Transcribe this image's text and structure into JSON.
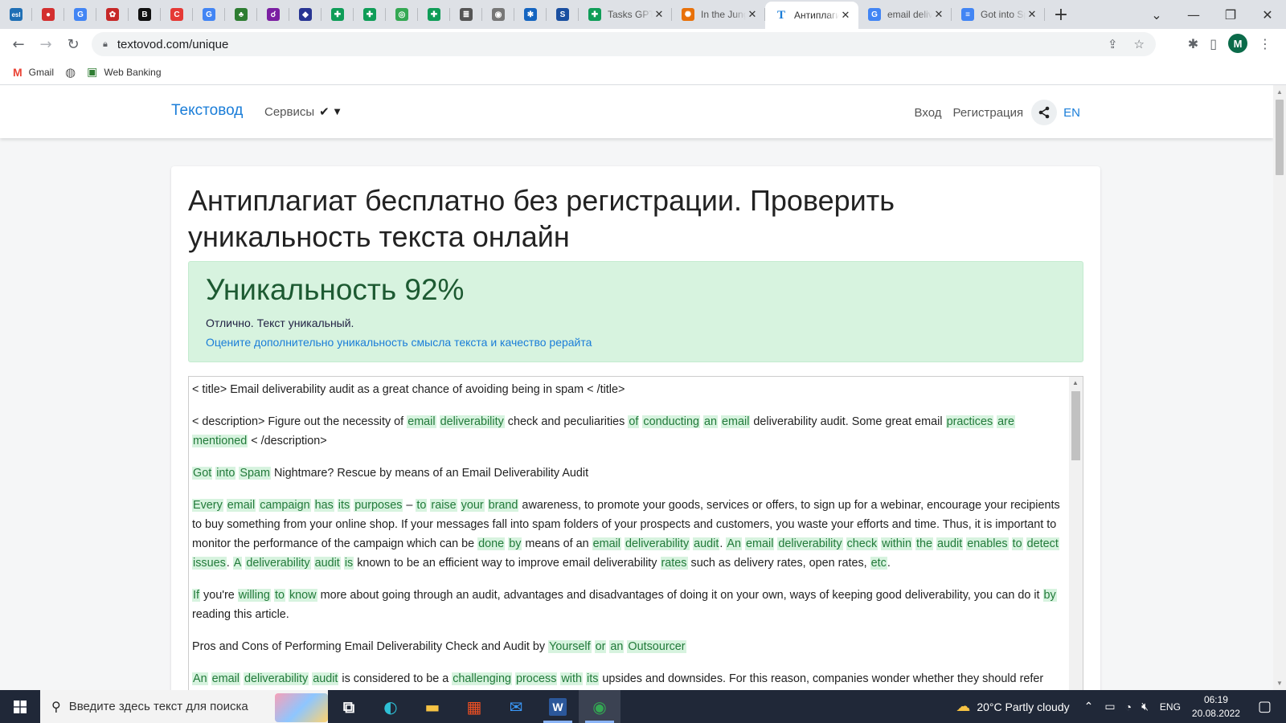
{
  "browser": {
    "pinned_tabs": [
      {
        "icon": "esl-icon",
        "glyph": "esl",
        "color": "#1f6fb5"
      },
      {
        "icon": "red-circle-icon",
        "glyph": "●",
        "color": "#d32f2f"
      },
      {
        "icon": "google-icon",
        "glyph": "G",
        "color": "#4285f4"
      },
      {
        "icon": "berry-icon",
        "glyph": "✿",
        "color": "#c62828"
      },
      {
        "icon": "b-icon",
        "glyph": "B",
        "color": "#111111"
      },
      {
        "icon": "c-icon",
        "glyph": "C",
        "color": "#e53935"
      },
      {
        "icon": "google-icon",
        "glyph": "G",
        "color": "#4285f4"
      },
      {
        "icon": "tree-icon",
        "glyph": "♣",
        "color": "#2e7d32"
      },
      {
        "icon": "gradient-swirl-icon",
        "glyph": "☌",
        "color": "#7b1fa2"
      },
      {
        "icon": "blue-shield-icon",
        "glyph": "◆",
        "color": "#283593"
      },
      {
        "icon": "sheets-icon",
        "glyph": "✚",
        "color": "#0f9d58"
      },
      {
        "icon": "sheets-icon",
        "glyph": "✚",
        "color": "#0f9d58"
      },
      {
        "icon": "green-doc-icon",
        "glyph": "◎",
        "color": "#34a853"
      },
      {
        "icon": "sheets-icon",
        "glyph": "✚",
        "color": "#0f9d58"
      },
      {
        "icon": "note-icon",
        "glyph": "≣",
        "color": "#555555"
      },
      {
        "icon": "eye-icon",
        "glyph": "◉",
        "color": "#777777"
      },
      {
        "icon": "puzzle-icon",
        "glyph": "✱",
        "color": "#1565c0"
      },
      {
        "icon": "circle-s-icon",
        "glyph": "S",
        "color": "#1a4fa0"
      }
    ],
    "tabs": [
      {
        "title": "Tasks GPT",
        "icon": "sheets-icon",
        "glyph": "✚",
        "color": "#0f9d58",
        "active": false
      },
      {
        "title": "In the Jungle",
        "icon": "chrome-web-icon",
        "glyph": "✺",
        "color": "#e8710a",
        "active": false
      },
      {
        "title": "Антиплагиат",
        "icon": "textovod-icon",
        "glyph": "T",
        "color": "#1a7dd8",
        "active": true
      },
      {
        "title": "email deliverability",
        "icon": "google-icon",
        "glyph": "G",
        "color": "#4285f4",
        "active": false
      },
      {
        "title": "Got into Spam",
        "icon": "docs-icon",
        "glyph": "≡",
        "color": "#4285f4",
        "active": false
      }
    ],
    "close_glyph": "✕",
    "new_tab": "+",
    "window_controls": [
      "⌄",
      "—",
      "❐",
      "✕"
    ],
    "url": "textovod.com/unique",
    "profile_initial": "M",
    "bookmarks": [
      {
        "label": "Gmail",
        "icon": "gmail-icon"
      },
      {
        "label": "",
        "icon": "globe-icon"
      },
      {
        "label": "Web Banking",
        "icon": "bank-icon"
      }
    ]
  },
  "site": {
    "brand": "Текстовод",
    "services": "Сервисы",
    "login": "Вход",
    "register": "Регистрация",
    "lang": "EN",
    "heading": "Антиплагиат бесплатно без регистрации. Проверить уникальность текста онлайн",
    "result": {
      "uniqueness": "Уникальность 92%",
      "verdict": "Отлично. Текст уникальный.",
      "rewrite_link": "Оцените дополнительно уникальность смысла текста и качество рерайта"
    },
    "paragraphs": [
      [
        [
          "< title> Email deliverability audit as a great chance of avoiding being in spam < /title>",
          0
        ]
      ],
      [
        [
          "< description> Figure out the necessity of ",
          0
        ],
        [
          "email",
          1
        ],
        [
          " ",
          0
        ],
        [
          "deliverability",
          1
        ],
        [
          " check and peculiarities ",
          0
        ],
        [
          "of",
          1
        ],
        [
          " ",
          0
        ],
        [
          "conducting",
          1
        ],
        [
          " ",
          0
        ],
        [
          "an",
          1
        ],
        [
          " ",
          0
        ],
        [
          "email",
          1
        ],
        [
          " deliverability audit. Some great email ",
          0
        ],
        [
          "practices",
          1
        ],
        [
          " ",
          0
        ],
        [
          "are",
          1
        ],
        [
          " ",
          0
        ],
        [
          "mentioned",
          1
        ],
        [
          " < /description>",
          0
        ]
      ],
      [
        [
          "Got",
          1
        ],
        [
          " ",
          0
        ],
        [
          "into",
          1
        ],
        [
          " ",
          0
        ],
        [
          "Spam",
          1
        ],
        [
          " Nightmare? Rescue by means of an Email Deliverability Audit",
          0
        ]
      ],
      [
        [
          "Every",
          1
        ],
        [
          " ",
          0
        ],
        [
          "email",
          1
        ],
        [
          " ",
          0
        ],
        [
          "campaign",
          1
        ],
        [
          " ",
          0
        ],
        [
          "has",
          1
        ],
        [
          " ",
          0
        ],
        [
          "its",
          1
        ],
        [
          " ",
          0
        ],
        [
          "purposes",
          1
        ],
        [
          " – ",
          0
        ],
        [
          "to",
          1
        ],
        [
          " ",
          0
        ],
        [
          "raise",
          1
        ],
        [
          " ",
          0
        ],
        [
          "your",
          1
        ],
        [
          " ",
          0
        ],
        [
          "brand",
          1
        ],
        [
          " awareness, to promote your goods, services or offers, to sign up for a webinar, encourage your recipients to buy something from your online shop. If your messages fall into spam folders of your prospects and customers, you waste your efforts and time. Thus, it is important to monitor the performance of the campaign which can be ",
          0
        ],
        [
          "done",
          1
        ],
        [
          " ",
          0
        ],
        [
          "by",
          1
        ],
        [
          " means of an ",
          0
        ],
        [
          "email",
          1
        ],
        [
          " ",
          0
        ],
        [
          "deliverability",
          1
        ],
        [
          " ",
          0
        ],
        [
          "audit",
          1
        ],
        [
          ". ",
          0
        ],
        [
          "An",
          1
        ],
        [
          " ",
          0
        ],
        [
          "email",
          1
        ],
        [
          " ",
          0
        ],
        [
          "deliverability",
          1
        ],
        [
          " ",
          0
        ],
        [
          "check",
          1
        ],
        [
          " ",
          0
        ],
        [
          "within",
          1
        ],
        [
          " ",
          0
        ],
        [
          "the",
          1
        ],
        [
          " ",
          0
        ],
        [
          "audit",
          1
        ],
        [
          " ",
          0
        ],
        [
          "enables",
          1
        ],
        [
          " ",
          0
        ],
        [
          "to",
          1
        ],
        [
          " ",
          0
        ],
        [
          "detect",
          1
        ],
        [
          " ",
          0
        ],
        [
          "issues",
          1
        ],
        [
          ". ",
          0
        ],
        [
          "A",
          1
        ],
        [
          " ",
          0
        ],
        [
          "deliverability",
          1
        ],
        [
          " ",
          0
        ],
        [
          "audit",
          1
        ],
        [
          " ",
          0
        ],
        [
          "is",
          1
        ],
        [
          " known to be an efficient way to improve email deliverability ",
          0
        ],
        [
          "rates",
          1
        ],
        [
          " such as delivery rates, open rates, ",
          0
        ],
        [
          "etc",
          1
        ],
        [
          ".",
          0
        ]
      ],
      [
        [
          "If",
          1
        ],
        [
          " you're ",
          0
        ],
        [
          "willing",
          1
        ],
        [
          " ",
          0
        ],
        [
          "to",
          1
        ],
        [
          " ",
          0
        ],
        [
          "know",
          1
        ],
        [
          " more about going through an audit, advantages and disadvantages of doing it on your own, ways of keeping good deliverability, you can do it ",
          0
        ],
        [
          "by",
          1
        ],
        [
          " reading this article.",
          0
        ]
      ],
      [
        [
          "Pros and Cons of Performing Email Deliverability Check and Audit by ",
          0
        ],
        [
          "Yourself",
          1
        ],
        [
          " ",
          0
        ],
        [
          "or",
          1
        ],
        [
          " ",
          0
        ],
        [
          "an",
          1
        ],
        [
          " ",
          0
        ],
        [
          "Outsourcer",
          1
        ]
      ],
      [
        [
          "An",
          1
        ],
        [
          " ",
          0
        ],
        [
          "email",
          1
        ],
        [
          " ",
          0
        ],
        [
          "deliverability",
          1
        ],
        [
          " ",
          0
        ],
        [
          "audit",
          1
        ],
        [
          " is considered to be a ",
          0
        ],
        [
          "challenging",
          1
        ],
        [
          " ",
          0
        ],
        [
          "process",
          1
        ],
        [
          " ",
          0
        ],
        [
          "with",
          1
        ],
        [
          " ",
          0
        ],
        [
          "its",
          1
        ],
        [
          " upsides and downsides. For this reason, companies wonder whether they should refer",
          0
        ]
      ]
    ]
  },
  "taskbar": {
    "search_placeholder": "Введите здесь текст для поиска",
    "apps": [
      {
        "icon": "task-view-icon",
        "on": false
      },
      {
        "icon": "edge-icon",
        "on": false
      },
      {
        "icon": "file-explorer-icon",
        "on": false
      },
      {
        "icon": "store-icon",
        "on": false
      },
      {
        "icon": "mail-icon",
        "on": false
      },
      {
        "icon": "word-icon",
        "on": true
      },
      {
        "icon": "chrome-icon",
        "on": true
      }
    ],
    "weather": "20°C  Partly cloudy",
    "lang": "ENG",
    "time": "06:19",
    "date": "20.08.2022"
  },
  "colors": {
    "accent": "#1a7dd8",
    "success_bg": "#d7f3df",
    "success_text": "#1d5a32",
    "highlight_text": "#227a3a"
  }
}
